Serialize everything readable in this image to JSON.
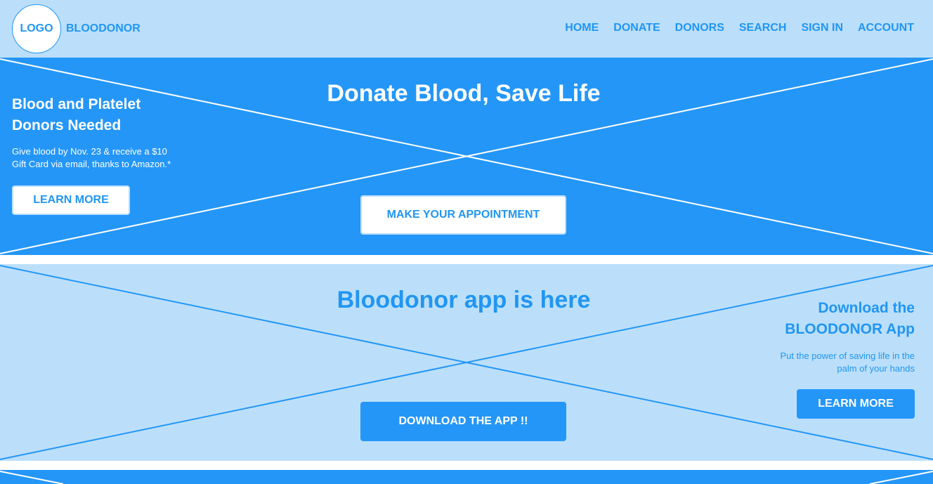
{
  "header": {
    "logo_label": "LOGO",
    "brand": "BLOODONOR",
    "nav": [
      "HOME",
      "DONATE",
      "DONORS",
      "SEARCH",
      "SIGN IN",
      "ACCOUNT"
    ]
  },
  "hero": {
    "title": "Donate Blood, Save Life",
    "side_title_line1": "Blood and Platelet",
    "side_title_line2": "Donors Needed",
    "side_text_line1": "Give blood by Nov. 23 & receive a $10",
    "side_text_line2": "Gift Card via email, thanks to Amazon.*",
    "learn_more": "LEARN MORE",
    "appointment": "MAKE YOUR APPOINTMENT"
  },
  "app_section": {
    "title": "Bloodonor app is here",
    "side_title_line1": "Download the",
    "side_title_line2": "BLOODONOR App",
    "side_text_line1": "Put the power of saving life in the",
    "side_text_line2": "palm of your hands",
    "learn_more": "LEARN MORE",
    "download": "DOWNLOAD THE APP !!"
  },
  "colors": {
    "primary": "#2496f8",
    "light": "#bbdffb",
    "white": "#ffffff"
  }
}
